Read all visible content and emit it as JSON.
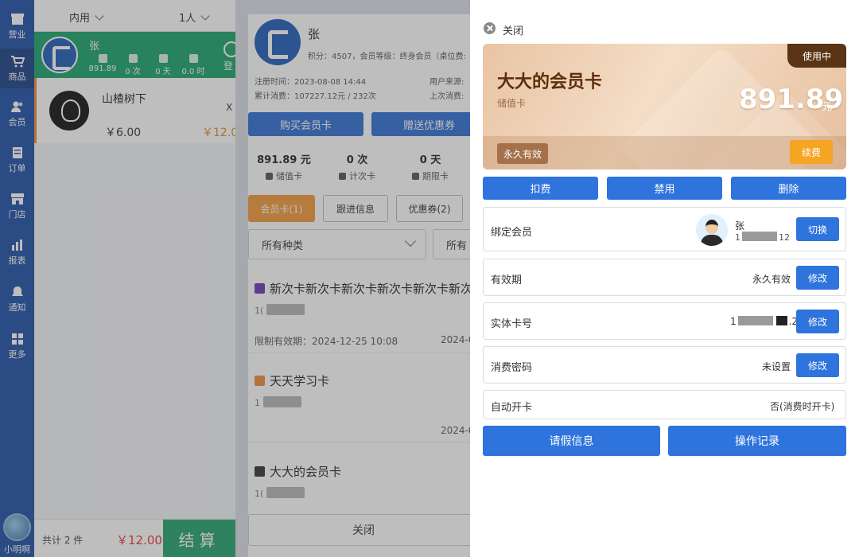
{
  "nav": {
    "items": [
      {
        "label": "营业",
        "icon": "shop-icon"
      },
      {
        "label": "商品",
        "icon": "cart-icon"
      },
      {
        "label": "会员",
        "icon": "users-icon"
      },
      {
        "label": "订单",
        "icon": "order-icon"
      },
      {
        "label": "门店",
        "icon": "store-icon"
      },
      {
        "label": "报表",
        "icon": "chart-icon"
      },
      {
        "label": "通知",
        "icon": "bell-icon"
      },
      {
        "label": "更多",
        "icon": "grid-icon"
      }
    ],
    "user": "小明啊"
  },
  "order": {
    "dropdown_type": "内用",
    "dropdown_people": "1人",
    "member_name": "张",
    "member_stats": [
      {
        "value": "891.89"
      },
      {
        "value": "0 次"
      },
      {
        "value": "0 天"
      },
      {
        "value": "0.0 时"
      }
    ],
    "login_label": "登",
    "product": {
      "name": "山楂树下",
      "qty": "X",
      "price": "￥6.00",
      "total": "￥12.00"
    },
    "footer": {
      "count": "共计 2 件",
      "sum": "￥12.00",
      "checkout": "结算"
    }
  },
  "detail": {
    "name": "张",
    "meta": "积分：4507，会员等级：终身会员（桌位费:",
    "register": "注册时间：2023-08-08 14:44",
    "source": "用户来源:",
    "spent": "累计消费：107227.12元 / 232次",
    "last": "上次消费:",
    "buy_button": "购买会员卡",
    "gift_button": "赠送优惠券",
    "stats": [
      {
        "value": "891.89 元",
        "label": "储值卡"
      },
      {
        "value": "0 次",
        "label": "计次卡"
      },
      {
        "value": "0 天",
        "label": "期限卡"
      }
    ],
    "tabs": [
      "会员卡(1)",
      "跟进信息",
      "优惠券(2)"
    ],
    "filter1": "所有种类",
    "filter2": "所有",
    "cards": [
      {
        "name": "新次卡新次卡新次卡新次卡新次卡新次",
        "id_prefix": "1(",
        "expiry": "限制有效期：2024-12-25 10:08",
        "date": "2024-0"
      },
      {
        "name": "天天学习卡",
        "id_prefix": "1",
        "date": "2024-0"
      },
      {
        "name": "大大的会员卡",
        "id_prefix": "1("
      }
    ],
    "close_button": "关闭"
  },
  "drawer": {
    "close_label": "关闭",
    "card": {
      "badge": "使用中",
      "title": "大大的会员卡",
      "type": "储值卡",
      "amount": "891.89",
      "unit": "元",
      "valid": "永久有效",
      "renew": "续费"
    },
    "actions": [
      "扣费",
      "禁用",
      "删除"
    ],
    "bind_member": {
      "label": "绑定会员",
      "name": "张",
      "phone_prefix": "1",
      "phone_suffix": "12",
      "button": "切换"
    },
    "validity": {
      "label": "有效期",
      "value": "永久有效",
      "button": "修改"
    },
    "card_no": {
      "label": "实体卡号",
      "prefix": "1",
      "suffix": ".2",
      "button": "修改"
    },
    "password": {
      "label": "消费密码",
      "value": "未设置",
      "button": "修改"
    },
    "auto_open": {
      "label": "自动开卡",
      "value": "否(消费时开卡)"
    },
    "bottom_buttons": [
      "请假信息",
      "操作记录"
    ]
  },
  "colors": {
    "nav": "#1e4fa6",
    "primary": "#2f74dc",
    "green": "#1aa36b",
    "orange": "#f29a3a",
    "card_title": "#5b2e0c"
  }
}
